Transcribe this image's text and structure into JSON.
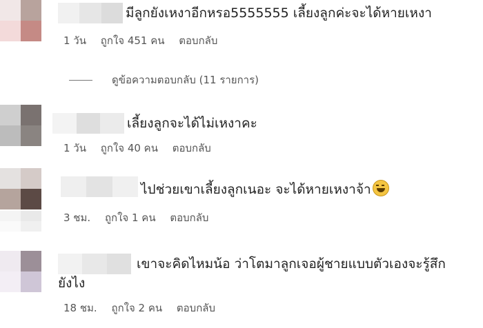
{
  "comments": [
    {
      "text": "มีลูกยังเหงาอีกหรอ5555555 เลี้ยงลูกค่ะจะได้หายเหงา",
      "time": "1 วัน",
      "likes": "ถูกใจ 451 คน",
      "reply": "ตอบกลับ"
    },
    {
      "text": "เลี้ยงลูกจะได้ไม่เหงาคะ",
      "time": "1 วัน",
      "likes": "ถูกใจ 40 คน",
      "reply": "ตอบกลับ"
    },
    {
      "text": "ไปช่วยเขาเลี้ยงลูกเนอะ จะได้หายเหงาจ้า",
      "emoji": "grinning-sweat-emoji",
      "time": "3 ชม.",
      "likes": "ถูกใจ 1 คน",
      "reply": "ตอบกลับ"
    },
    {
      "text_line1": "เขาจะคิดไหมน้อ ว่าโตมาลูกเจอผู้ชายแบบตัวเองจะรู้สึก",
      "text_line2": "ยังไง",
      "time": "18 ชม.",
      "likes": "ถูกใจ 2 คน",
      "reply": "ตอบกลับ"
    }
  ],
  "view_replies": "ดูข้อความตอบกลับ (11 รายการ)",
  "colors": {
    "text": "#222222",
    "meta": "#555555",
    "background": "#ffffff",
    "blur": "#e6e6e6"
  }
}
